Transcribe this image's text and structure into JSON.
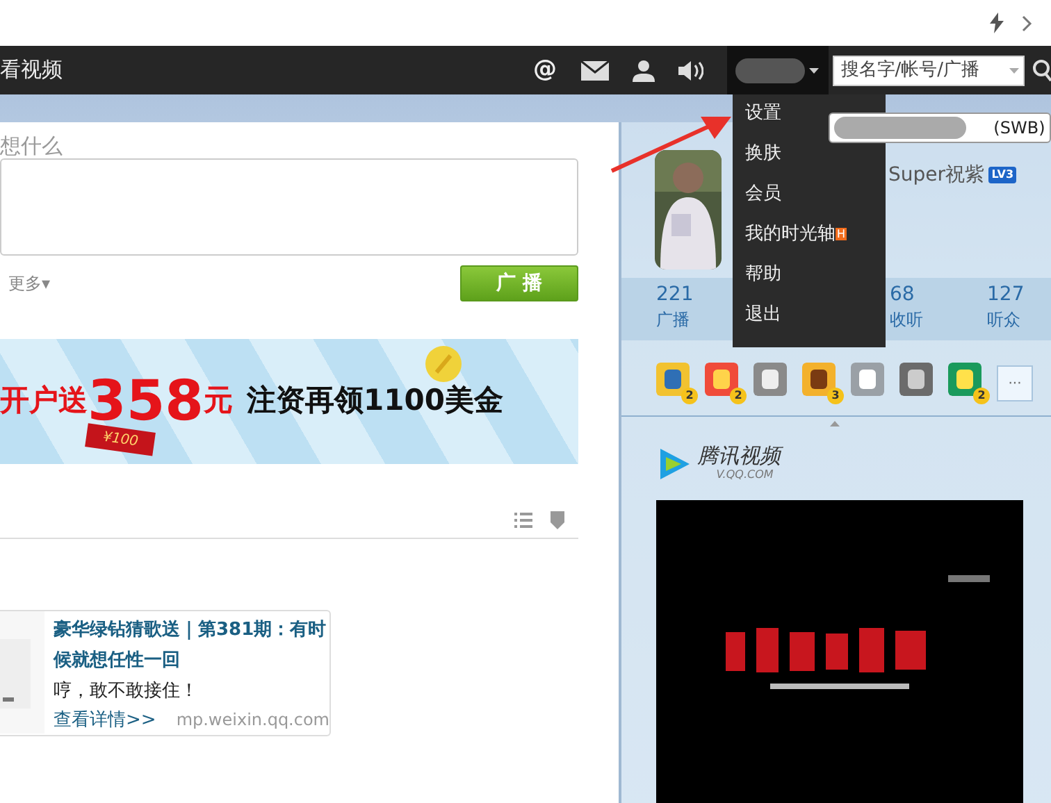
{
  "nav": {
    "title": "看视频",
    "at_icon": "@",
    "search": {
      "placeholder": "搜名字/帐号/广播"
    }
  },
  "user_menu": {
    "items": [
      {
        "label": "设置",
        "new": false
      },
      {
        "label": "换肤",
        "new": false
      },
      {
        "label": "会员",
        "new": false
      },
      {
        "label": "我的时光轴",
        "new": true,
        "badge": "H"
      },
      {
        "label": "帮助",
        "new": false
      },
      {
        "label": "退出",
        "new": false
      }
    ]
  },
  "tooltip": {
    "text": "(SWB)"
  },
  "composer": {
    "prompt": "想什么",
    "more": "更多▾",
    "submit": "广 播"
  },
  "banner": {
    "lead": "开户送",
    "amount": "358",
    "unit": "元",
    "tail": "注资再领1100美金",
    "coupon": "¥100"
  },
  "feed_card": {
    "title": "豪华绿钻猜歌送｜第381期：有时候就想任性一回",
    "text": "哼，敢不敢接住！",
    "link": "查看详情>>",
    "source": "mp.weixin.qq.com"
  },
  "profile": {
    "name": "Super祝紫",
    "level": "LV3"
  },
  "stats": [
    {
      "value": "221",
      "label": "广播"
    },
    {
      "value": "68",
      "label": "收听"
    },
    {
      "value": "127",
      "label": "听众"
    }
  ],
  "apps": [
    {
      "kind": "book",
      "count": "2"
    },
    {
      "kind": "heart",
      "count": "2"
    },
    {
      "kind": "ring"
    },
    {
      "kind": "face",
      "count": "3"
    },
    {
      "kind": "phone"
    },
    {
      "kind": "music"
    },
    {
      "kind": "chat",
      "count": "2"
    }
  ],
  "apps_more": "···",
  "video": {
    "brand": "腾讯视频",
    "domain": "V.QQ.COM"
  }
}
